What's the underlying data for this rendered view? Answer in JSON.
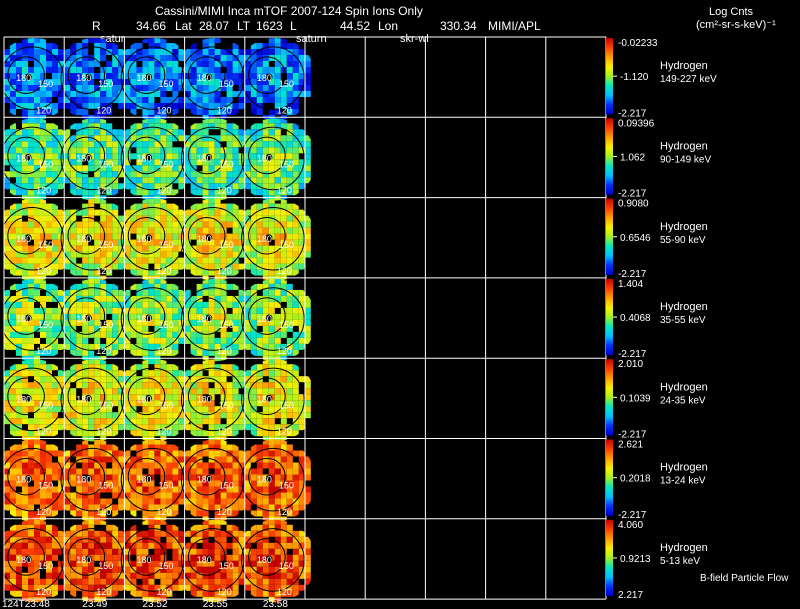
{
  "header": {
    "title": "Cassini/MIMI Inca mTOF  2007-124   Spin   Ions Only",
    "r_label": "R",
    "r_value": "34.66",
    "lat_label": "Lat",
    "lat_value": "28.07",
    "lt_label": "LT",
    "lt_value": "1623",
    "l_label": "L",
    "lon_value": "44.52",
    "lon_label": "Lon",
    "skr_value": "330.34",
    "credit": "MIMI/APL",
    "overlay_1": "satur",
    "overlay_2": "saturn",
    "overlay_3": "skr-wl",
    "units_line1": "Log Cnts",
    "units_line2": "(cm²-sr-s-keV)⁻¹"
  },
  "footer": {
    "bfield_label": "B-field Particle Flow"
  },
  "colors": {
    "background": "#000000",
    "grid": "#ffffff",
    "colorbar": [
      "#0000c8",
      "#0030ff",
      "#00c0ff",
      "#00e8c0",
      "#a8f020",
      "#f8f000",
      "#ffa000",
      "#ff4000",
      "#c80000"
    ]
  },
  "chart_data": {
    "type": "heatmap",
    "description_note": "",
    "time_labels": [
      "124T23:48",
      "23:49",
      "23:52",
      "23:55",
      "23:58"
    ],
    "filled_columns": 5,
    "total_columns": 10,
    "ring_labels": [
      "180",
      "150",
      "120"
    ],
    "channels": [
      {
        "species": "Hydrogen",
        "energy": "149-227 keV",
        "cb_max": "-0.02233",
        "cb_mid": "-1.120",
        "cb_min": "-2.217",
        "level": 0.15
      },
      {
        "species": "Hydrogen",
        "energy": "90-149 keV",
        "cb_max": "0.09396",
        "cb_mid": "1.062",
        "cb_min": "-2.217",
        "level": 0.38
      },
      {
        "species": "Hydrogen",
        "energy": "55-90 keV",
        "cb_max": "0.9080",
        "cb_mid": "0.6546",
        "cb_min": "-2.217",
        "level": 0.55
      },
      {
        "species": "Hydrogen",
        "energy": "35-55 keV",
        "cb_max": "1.404",
        "cb_mid": "0.4068",
        "cb_min": "-2.217",
        "level": 0.45
      },
      {
        "species": "Hydrogen",
        "energy": "24-35 keV",
        "cb_max": "2.010",
        "cb_mid": "0.1039",
        "cb_min": "-2.217",
        "level": 0.55
      },
      {
        "species": "Hydrogen",
        "energy": "13-24 keV",
        "cb_max": "2.621",
        "cb_mid": "0.2018",
        "cb_min": "-2.217",
        "level": 0.78
      },
      {
        "species": "Hydrogen",
        "energy": "5-13 keV",
        "cb_max": "4.060",
        "cb_mid": "0.9213",
        "cb_min": "2.217",
        "level": 0.82
      }
    ]
  }
}
